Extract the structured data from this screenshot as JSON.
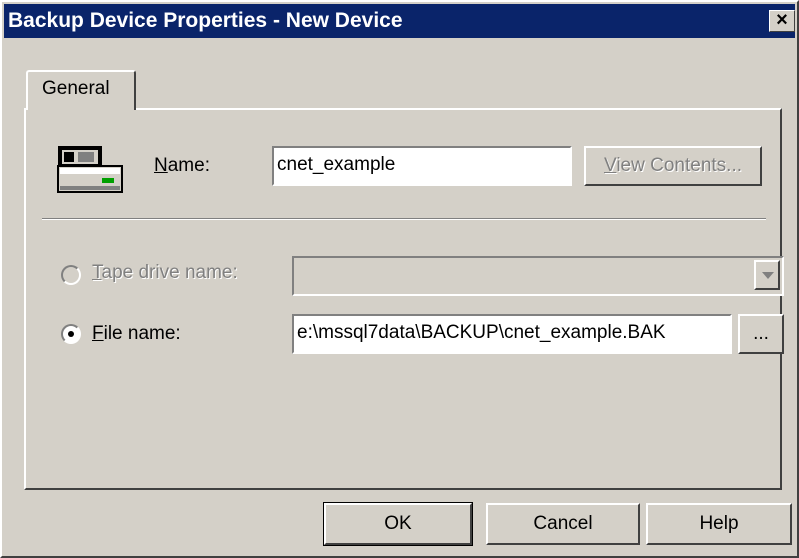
{
  "window": {
    "title": "Backup Device Properties - New Device",
    "close_label": "×"
  },
  "tabs": [
    {
      "label": "General"
    }
  ],
  "general": {
    "name_label_first": "N",
    "name_label_rest": "ame:",
    "name_value": "cnet_example",
    "view_contents_first": "V",
    "view_contents_rest": "iew Contents...",
    "tape_first": "T",
    "tape_rest": "ape drive name:",
    "tape_value": "",
    "file_first": "F",
    "file_rest": "ile name:",
    "file_value": "e:\\mssql7data\\BACKUP\\cnet_example.BAK",
    "browse_label": "..."
  },
  "buttons": {
    "ok": "OK",
    "cancel": "Cancel",
    "help": "Help"
  },
  "state": {
    "tape_selected": false,
    "file_selected": true
  }
}
